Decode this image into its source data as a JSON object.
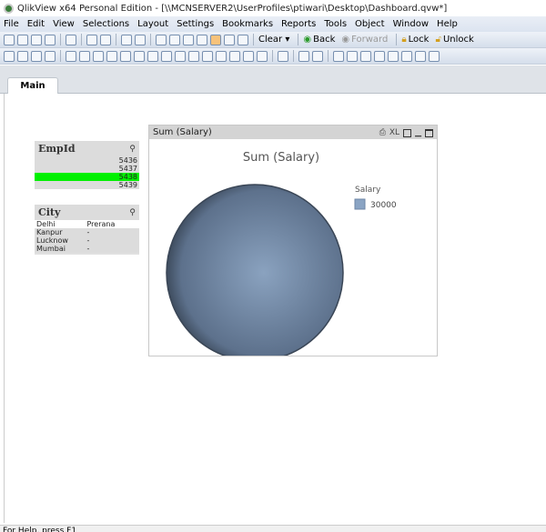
{
  "window": {
    "title": "QlikView x64 Personal Edition - [\\\\MCNSERVER2\\UserProfiles\\ptiwari\\Desktop\\Dashboard.qvw*]"
  },
  "menu": [
    "File",
    "Edit",
    "View",
    "Selections",
    "Layout",
    "Settings",
    "Bookmarks",
    "Reports",
    "Tools",
    "Object",
    "Window",
    "Help"
  ],
  "toolbar": {
    "clear": "Clear ▾",
    "back": "Back",
    "forward": "Forward",
    "lock": "Lock",
    "unlock": "Unlock"
  },
  "tabs": [
    {
      "label": "Main"
    }
  ],
  "empid": {
    "title": "EmpId",
    "values": [
      "5436",
      "5437",
      "5438",
      "5439"
    ],
    "selected": "5438"
  },
  "city": {
    "title": "City",
    "rows": [
      [
        "Delhi",
        "Prerana"
      ],
      [
        "Kanpur",
        "-"
      ],
      [
        "Lucknow",
        "-"
      ],
      [
        "Mumbai",
        "-"
      ]
    ]
  },
  "chart": {
    "caption": "Sum (Salary)",
    "title": "Sum (Salary)",
    "icons": {
      "print": "⎙",
      "xl": "XL"
    },
    "chart_data": {
      "type": "pie",
      "title": "Sum (Salary)",
      "legend_title": "Salary",
      "legend_position": "right",
      "slices": [
        {
          "label": "30000",
          "value": 30000,
          "color": "#8aa4c4"
        }
      ]
    }
  },
  "status": "For Help, press F1"
}
